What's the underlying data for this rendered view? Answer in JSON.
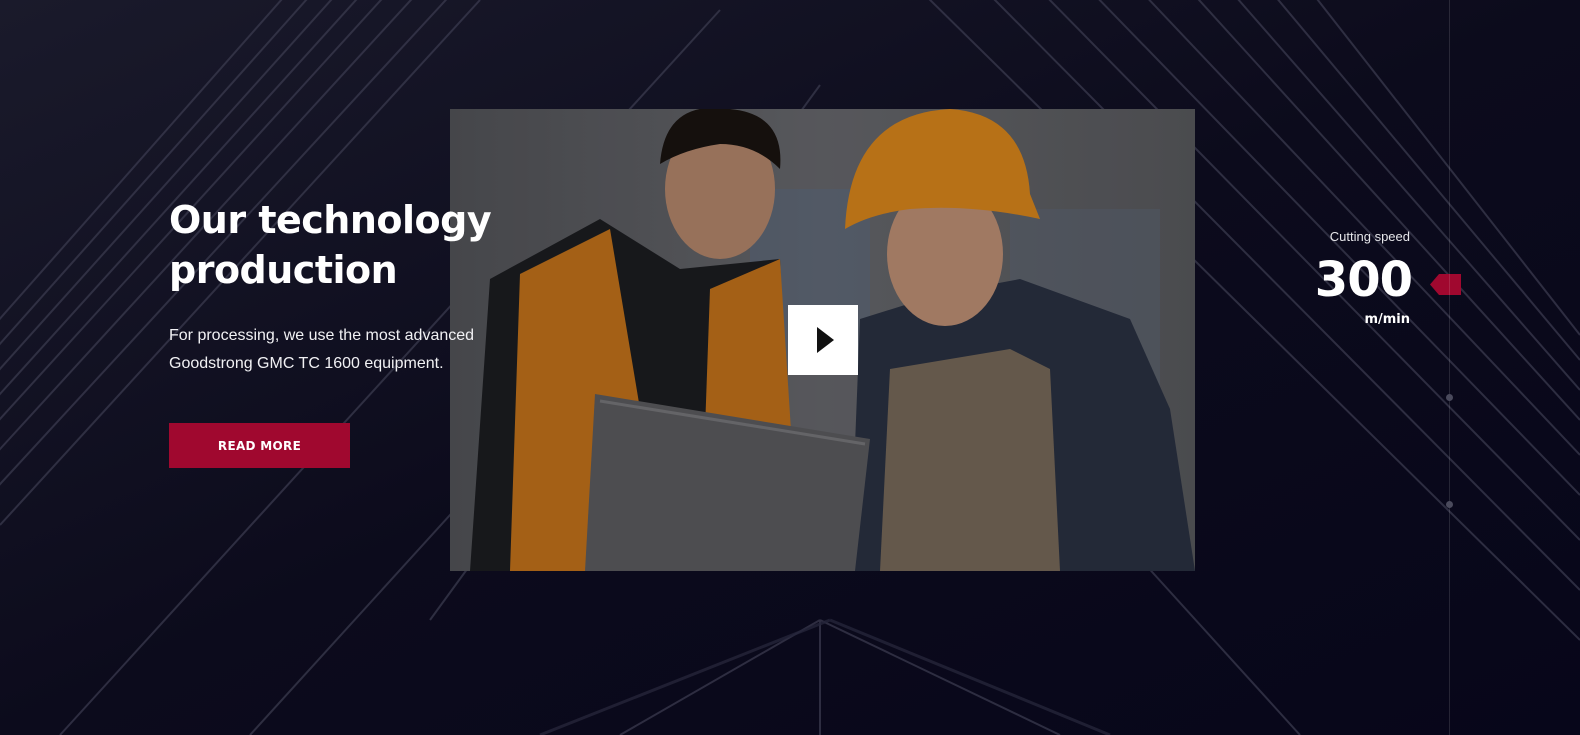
{
  "hero": {
    "title": "Our technology production",
    "description": "For processing, we use the most advanced Goodstrong GMC TC 1600 equipment.",
    "read_more_label": "READ MORE"
  },
  "video": {
    "thumbnail": "two-workers-with-laptop-photo",
    "play_icon": "play-icon"
  },
  "stats": {
    "label": "Cutting speed",
    "value": "300",
    "unit": "m/min"
  },
  "colors": {
    "background": "#0b0a1a",
    "accent": "#a0082f",
    "text": "#ffffff"
  }
}
